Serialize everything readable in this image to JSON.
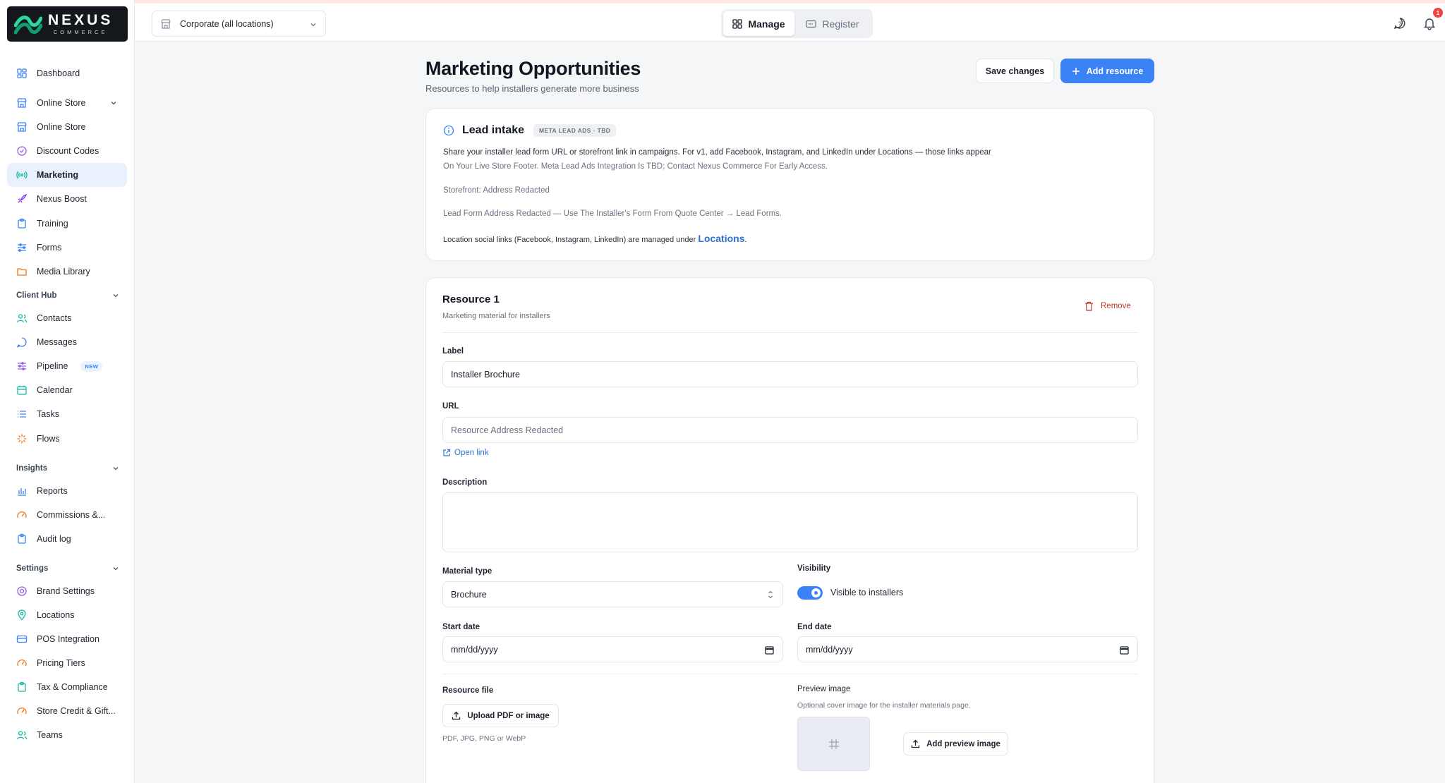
{
  "brand": {
    "name": "NEXUS",
    "tagline": "COMMERCE"
  },
  "sidebar": {
    "items": [
      {
        "label": "Dashboard",
        "icon": "dashboard-icon",
        "color": "#3b82f6"
      },
      {
        "label": "Online Store",
        "icon": "store-icon",
        "color": "#3b82f6",
        "expandable": true
      },
      {
        "label": "Online Store",
        "icon": "store-icon",
        "color": "#3b82f6"
      },
      {
        "label": "Discount Codes",
        "icon": "discount-icon",
        "color": "#9b5de5"
      },
      {
        "label": "Marketing",
        "icon": "broadcast-icon",
        "color": "#14b8a6",
        "active": true
      },
      {
        "label": "Nexus Boost",
        "icon": "rocket-icon",
        "color": "#7c3aed"
      },
      {
        "label": "Training",
        "icon": "clipboard-icon",
        "color": "#3b82f6"
      },
      {
        "label": "Forms",
        "icon": "sliders-icon",
        "color": "#3b82f6"
      },
      {
        "label": "Media Library",
        "icon": "folder-icon",
        "color": "#f97316"
      }
    ],
    "sections": [
      {
        "title": "Client Hub",
        "items": [
          {
            "label": "Contacts",
            "icon": "users-icon",
            "color": "#14b8a6"
          },
          {
            "label": "Messages",
            "icon": "chat-icon",
            "color": "#3b82f6"
          },
          {
            "label": "Pipeline",
            "icon": "pipeline-icon",
            "color": "#9b5de5",
            "badge": "NEW"
          },
          {
            "label": "Calendar",
            "icon": "calendar-icon",
            "color": "#14b8a6"
          },
          {
            "label": "Tasks",
            "icon": "list-icon",
            "color": "#3b82f6"
          },
          {
            "label": "Flows",
            "icon": "flows-icon",
            "color": "#f97316"
          }
        ]
      },
      {
        "title": "Insights",
        "items": [
          {
            "label": "Reports",
            "icon": "bar-chart-icon",
            "color": "#3b82f6"
          },
          {
            "label": "Commissions &...",
            "icon": "gauge-icon",
            "color": "#f97316"
          },
          {
            "label": "Audit log",
            "icon": "clipboard-icon",
            "color": "#3b82f6"
          }
        ]
      },
      {
        "title": "Settings",
        "items": [
          {
            "label": "Brand Settings",
            "icon": "palette-icon",
            "color": "#9b5de5"
          },
          {
            "label": "Locations",
            "icon": "pin-icon",
            "color": "#14b8a6"
          },
          {
            "label": "POS Integration",
            "icon": "card-icon",
            "color": "#3b82f6"
          },
          {
            "label": "Pricing Tiers",
            "icon": "gauge-icon",
            "color": "#f97316"
          },
          {
            "label": "Tax & Compliance",
            "icon": "clipboard-icon",
            "color": "#14b8a6"
          },
          {
            "label": "Store Credit & Gift...",
            "icon": "gauge-icon",
            "color": "#f97316"
          },
          {
            "label": "Teams",
            "icon": "users-icon",
            "color": "#14b8a6"
          }
        ]
      }
    ]
  },
  "header": {
    "location": "Corporate (all locations)",
    "tabs": [
      {
        "label": "Manage",
        "active": true
      },
      {
        "label": "Register",
        "active": false
      }
    ],
    "notification_count": "1"
  },
  "page": {
    "title": "Marketing Opportunities",
    "subtitle": "Resources to help installers generate more business",
    "save_label": "Save changes",
    "add_label": "Add resource"
  },
  "lead": {
    "title": "Lead intake",
    "badge": "META LEAD ADS · TBD",
    "line1": "Share your installer lead form URL or storefront link in campaigns. For v1, add Facebook, Instagram, and LinkedIn under Locations — those links appear",
    "line2": "On Your Live Store Footer. Meta Lead Ads Integration Is TBD; Contact Nexus Commerce For Early Access.",
    "storefront": "Storefront: Address Redacted",
    "leadform": "Lead Form Address Redacted — Use The Installer's Form From Quote Center → Lead Forms.",
    "social_prefix": "Location social links (Facebook, Instagram, LinkedIn) are managed under",
    "social_link": "Locations",
    "social_suffix": "."
  },
  "resource": {
    "title": "Resource 1",
    "subtitle": "Marketing material for installers",
    "remove_label": "Remove",
    "label_label": "Label",
    "label_value": "Installer Brochure",
    "url_label": "URL",
    "url_placeholder": "Resource Address Redacted",
    "open_link": "Open link",
    "description_label": "Description",
    "description_value": "",
    "material_label": "Material type",
    "material_value": "Brochure",
    "visibility_label": "Visibility",
    "visibility_value": "Visible to installers",
    "visible": true,
    "start_label": "Start date",
    "start_value": "mm/dd/yyyy",
    "end_label": "End date",
    "end_value": "mm/dd/yyyy",
    "file_label": "Resource file",
    "upload_label": "Upload PDF or image",
    "file_hint": "PDF, JPG, PNG or WebP",
    "preview_label": "Preview image",
    "preview_hint": "Optional cover image for the installer materials page.",
    "preview_button": "Add preview image"
  },
  "colors": {
    "accent": "#3b82f6",
    "danger": "#c0392b",
    "active_bg": "#e8f1fd"
  }
}
